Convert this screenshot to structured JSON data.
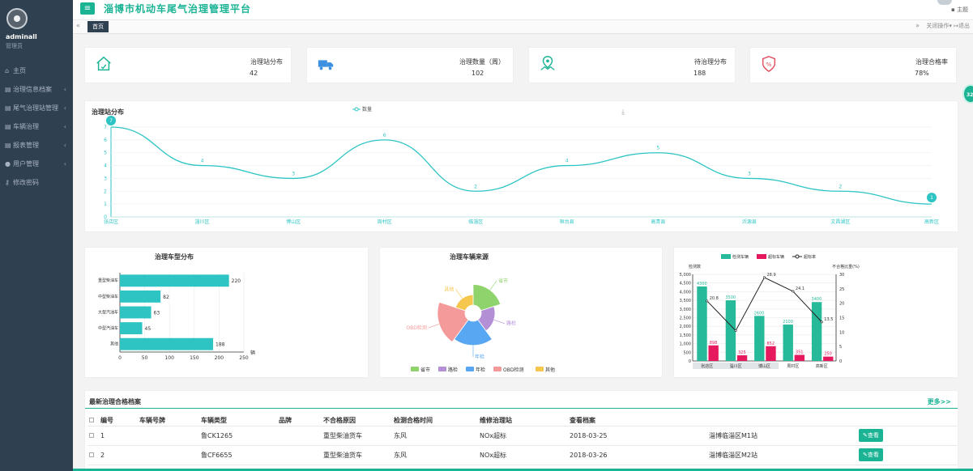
{
  "user": {
    "name": "adminall",
    "role": "管理员"
  },
  "app_title": "淄博市机动车尾气治理管理平台",
  "theme_label": "主题",
  "nav": [
    {
      "label": "主页",
      "icon": "home-icon",
      "has_arrow": false
    },
    {
      "label": "治理信息档案",
      "icon": "archive-icon",
      "has_arrow": true
    },
    {
      "label": "尾气治理站管理",
      "icon": "station-icon",
      "has_arrow": true
    },
    {
      "label": "车辆治理",
      "icon": "car-icon",
      "has_arrow": true
    },
    {
      "label": "报表管理",
      "icon": "report-icon",
      "has_arrow": true
    },
    {
      "label": "用户管理",
      "icon": "user-icon",
      "has_arrow": true
    },
    {
      "label": "修改密码",
      "icon": "key-icon",
      "has_arrow": false
    }
  ],
  "tabs": {
    "home": "首页",
    "ops": "关闭操作",
    "logout": "退出"
  },
  "stats": [
    {
      "label": "治理站分布",
      "value": "42",
      "icon": "house-icon"
    },
    {
      "label": "治理数量（周）",
      "value": "102",
      "icon": "truck-icon"
    },
    {
      "label": "待治理分布",
      "value": "188",
      "icon": "map-pin-icon"
    },
    {
      "label": "治理合格率",
      "value": "78%",
      "icon": "percent-shield-icon"
    }
  ],
  "badge": "32",
  "chart_data": [
    {
      "type": "line",
      "title": "治理站分布",
      "series": [
        {
          "name": "数量",
          "values": [
            7,
            4,
            3,
            6,
            2,
            4,
            5,
            3,
            2,
            1
          ]
        }
      ],
      "categories": [
        "张店区",
        "淄川区",
        "博山区",
        "周村区",
        "临淄区",
        "桓台县",
        "高青县",
        "沂源县",
        "文昌湖区",
        "高新区"
      ],
      "ylim": [
        0,
        7
      ],
      "yticks": [
        0,
        1,
        2,
        3,
        4,
        5,
        6,
        7
      ],
      "color": "#2ec4c4"
    },
    {
      "type": "bar",
      "orientation": "horizontal",
      "title": "治理车型分布",
      "categories": [
        "重型柴油车",
        "中型柴油车",
        "大型汽油车",
        "中型汽油车",
        "其他"
      ],
      "values": [
        220,
        82,
        63,
        45,
        188
      ],
      "xlim": [
        0,
        250
      ],
      "xticks": [
        0,
        50,
        100,
        150,
        200,
        250
      ],
      "xlabel": "辆",
      "color": "#2ec4c4"
    },
    {
      "type": "pie",
      "subtype": "rose",
      "title": "治理车辆来源",
      "slices": [
        {
          "name": "省市",
          "value": 6,
          "color": "#8ed36b"
        },
        {
          "name": "路检",
          "value": 4,
          "color": "#b38fd6"
        },
        {
          "name": "年检",
          "value": 7,
          "color": "#58a7f2"
        },
        {
          "name": "OBD检测",
          "value": 8,
          "color": "#f59a9a"
        },
        {
          "name": "其他",
          "value": 3,
          "color": "#f5c74d"
        }
      ],
      "legend": "bottom"
    },
    {
      "type": "bar",
      "title": "",
      "categories": [
        "张店区",
        "淄川区",
        "博山区",
        "周村区",
        "高新区"
      ],
      "series": [
        {
          "name": "检测车辆",
          "values": [
            4300,
            3500,
            2600,
            2100,
            3400
          ],
          "color": "#26b99a"
        },
        {
          "name": "超标车辆",
          "values": [
            898,
            325,
            852,
            351,
            250
          ],
          "color": "#e6195f"
        },
        {
          "name": "超标率",
          "type": "line",
          "axis": "right",
          "values": [
            20.8,
            10.5,
            28.9,
            24.1,
            13.5
          ],
          "color": "#222222"
        }
      ],
      "bar_labels": [
        "4300",
        "3500",
        "2600",
        "2100",
        "3400"
      ],
      "sub_labels": [
        "898",
        "325",
        "852",
        "351",
        "250"
      ],
      "line_labels": [
        "20.8",
        "",
        "28.9",
        "24.1",
        "13.5"
      ],
      "ylabel": "检测数",
      "y2label": "不合格比重(%)",
      "ylim": [
        0,
        5000
      ],
      "yticks": [
        0,
        500,
        1000,
        1500,
        2000,
        2500,
        3000,
        3500,
        4000,
        4500,
        5000
      ],
      "y2lim": [
        0,
        30
      ],
      "y2ticks": [
        0,
        5,
        10,
        15,
        20,
        25,
        30
      ],
      "legend": "top"
    }
  ],
  "table": {
    "title": "最新治理合格档案",
    "more": "更多>>",
    "headers": [
      "编号",
      "车辆号牌",
      "车辆类型",
      "品牌",
      "不合格原因",
      "检测合格时间",
      "维修治理站",
      "查看档案"
    ],
    "rows": [
      {
        "no": "1",
        "plate": "鲁CK1265",
        "type": "重型柴油货车",
        "brand": "东风",
        "reason": "NOx超标",
        "date": "2018-03-25",
        "station": "淄博临淄区M1站",
        "action": "查看"
      },
      {
        "no": "2",
        "plate": "鲁CF6655",
        "type": "重型柴油货车",
        "brand": "东风",
        "reason": "NOx超标",
        "date": "2018-03-26",
        "station": "淄博临淄区M2站",
        "action": "查看"
      }
    ]
  }
}
